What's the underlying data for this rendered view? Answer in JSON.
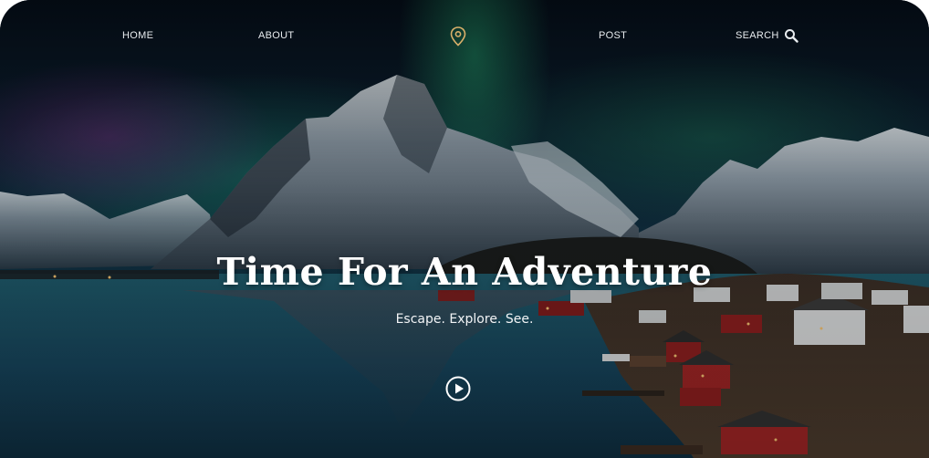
{
  "nav": {
    "home_label": "HOME",
    "about_label": "ABOUT",
    "post_label": "POST",
    "search_label": "SEARCH",
    "logo_icon": "map-pin-icon",
    "search_icon": "search-icon"
  },
  "hero": {
    "title": "Time For An Adventure",
    "subtitle": "Escape. Explore. See.",
    "play_icon": "play-circle-icon"
  },
  "colors": {
    "text": "#ffffff",
    "nav_text": "#e8ecef",
    "accent_pin": "#d9b06a",
    "background_dark": "#0b1620"
  }
}
